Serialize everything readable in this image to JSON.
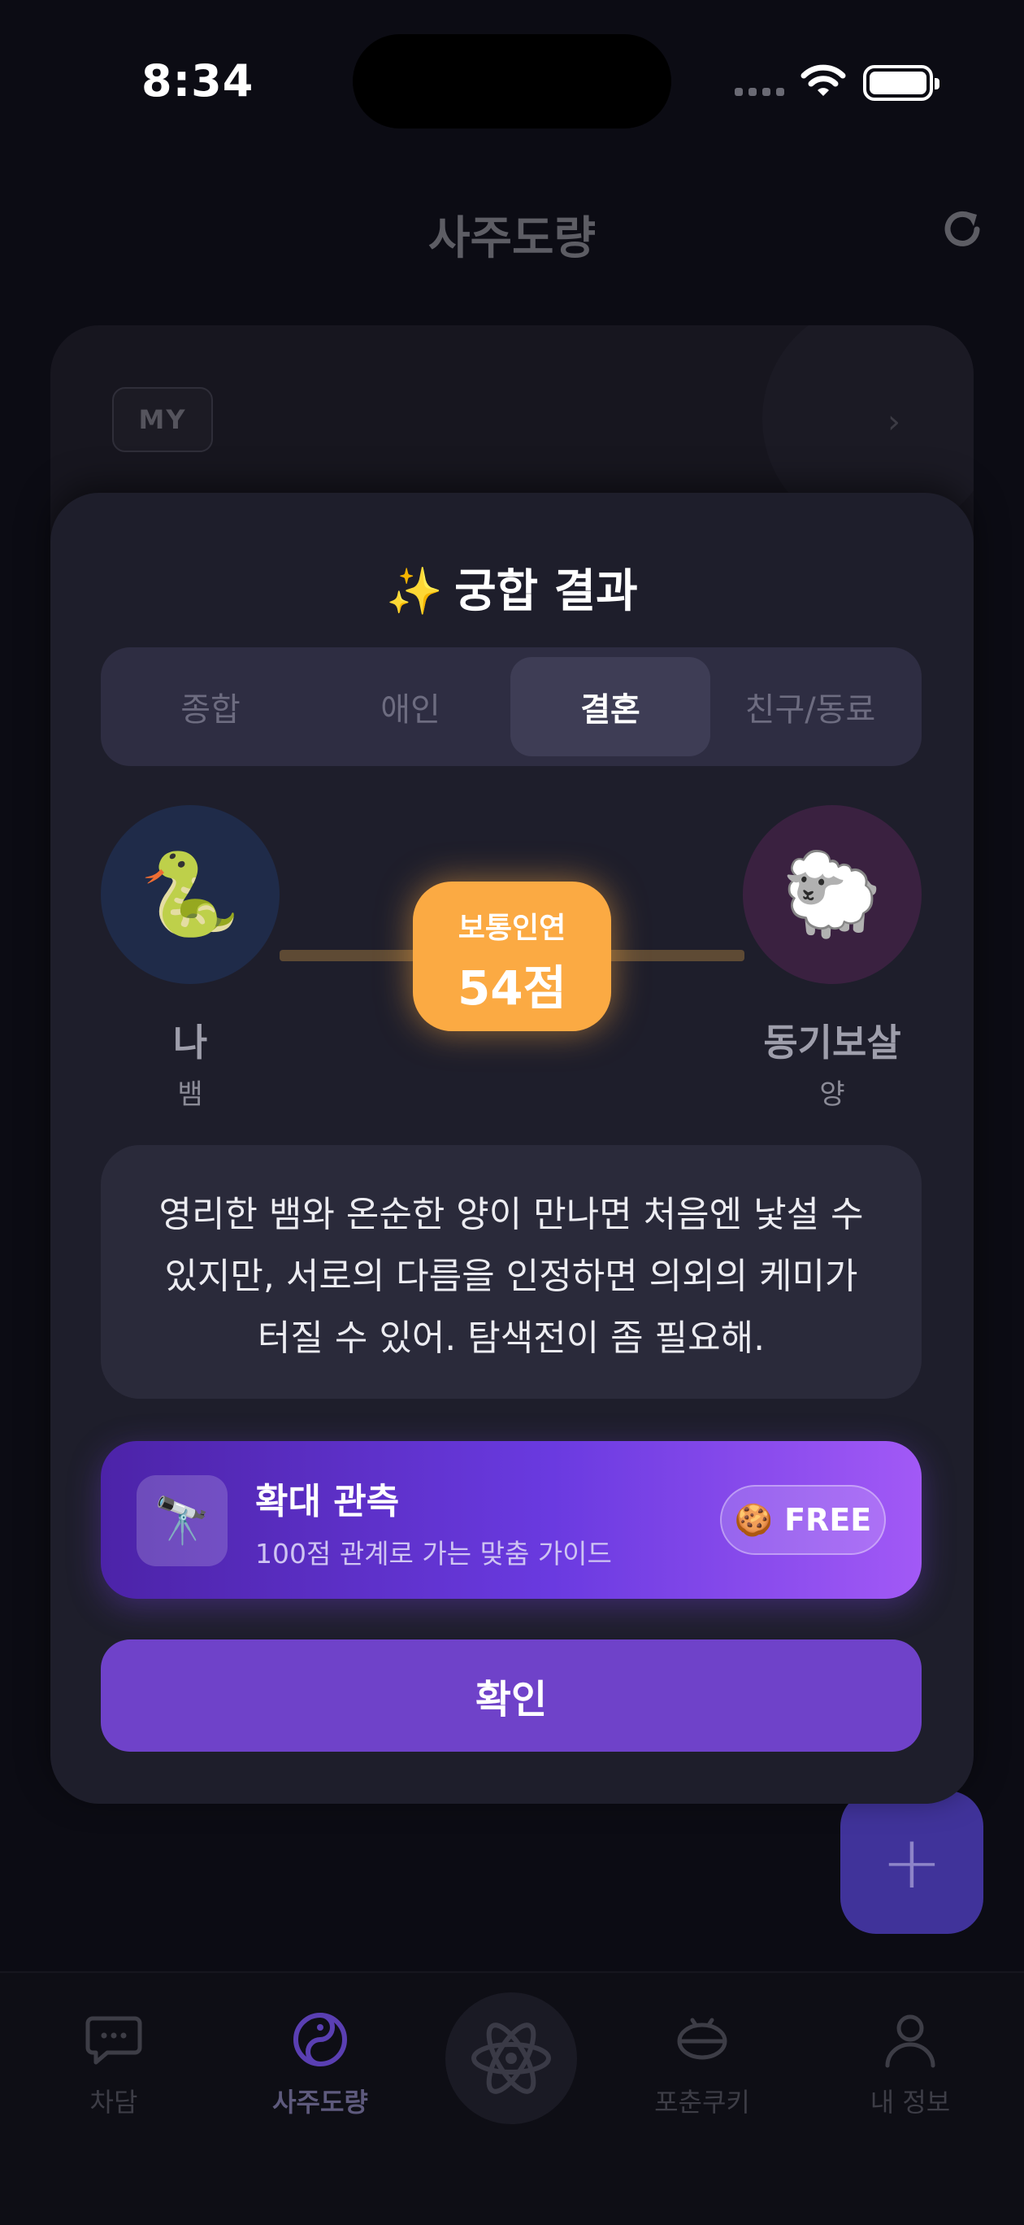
{
  "status_bar": {
    "time": "8:34"
  },
  "header": {
    "title": "사주도량"
  },
  "background_card": {
    "badge": "MY"
  },
  "modal": {
    "title": "궁합 결과",
    "tabs": [
      {
        "label": "종합",
        "active": false
      },
      {
        "label": "애인",
        "active": false
      },
      {
        "label": "결혼",
        "active": true
      },
      {
        "label": "친구/동료",
        "active": false
      }
    ],
    "me": {
      "emoji": "🐍",
      "name": "나",
      "animal": "뱀"
    },
    "partner": {
      "emoji": "🐑",
      "name": "동기보살",
      "animal": "양"
    },
    "score": {
      "label": "보통인연",
      "value": "54점"
    },
    "description": "영리한 뱀와 온순한 양이 만나면 처음엔 낯설 수 있지만, 서로의 다름을 인정하면 의외의 케미가 터질 수 있어. 탐색전이 좀 필요해.",
    "expand": {
      "icon": "🔭",
      "title": "확대 관측",
      "subtitle": "100점 관계로 가는 맞춤 가이드",
      "pill_icon": "🍪",
      "pill_label": "FREE"
    },
    "confirm_label": "확인"
  },
  "fab": {
    "label": "+"
  },
  "tab_bar": {
    "items": [
      {
        "label": "차담",
        "icon": "chat-icon",
        "active": false
      },
      {
        "label": "사주도량",
        "icon": "yin-yang-icon",
        "active": true
      },
      {
        "label": "",
        "icon": "atom-icon",
        "active": false
      },
      {
        "label": "포춘쿠키",
        "icon": "fortune-cookie-icon",
        "active": false
      },
      {
        "label": "내 정보",
        "icon": "person-icon",
        "active": false
      }
    ]
  },
  "colors": {
    "accent": "#6f42c9",
    "score": "#fbaa43",
    "modal_bg": "#1e1e2b"
  }
}
